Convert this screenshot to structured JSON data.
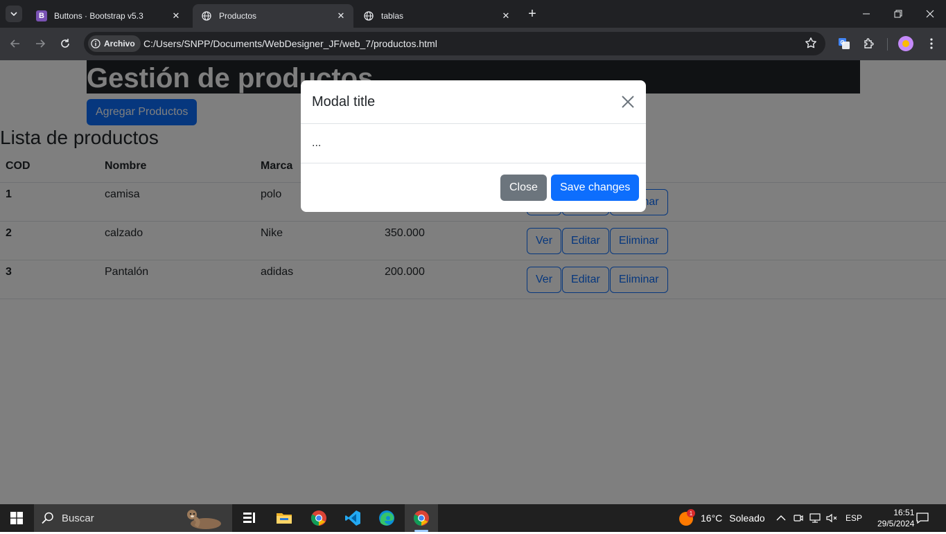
{
  "browser": {
    "tabs": [
      {
        "title": "Buttons · Bootstrap v5.3",
        "active": false
      },
      {
        "title": "Productos",
        "active": true
      },
      {
        "title": "tablas",
        "active": false
      }
    ],
    "security_chip": "Archivo",
    "url": "C:/Users/SNPP/Documents/WebDesigner_JF/web_7/productos.html",
    "bootstrap_favicon_letter": "B"
  },
  "page": {
    "heading": "Gestión de productos",
    "add_button": "Agregar Productos",
    "list_title": "Lista de productos",
    "table": {
      "headers": [
        "COD",
        "Nombre",
        "Marca",
        "",
        ""
      ],
      "rows": [
        {
          "cod": "1",
          "nombre": "camisa",
          "marca": "polo",
          "precio": ""
        },
        {
          "cod": "2",
          "nombre": "calzado",
          "marca": "Nike",
          "precio": "350.000"
        },
        {
          "cod": "3",
          "nombre": "Pantalón",
          "marca": "adidas",
          "precio": "200.000"
        }
      ],
      "actions": {
        "view": "Ver",
        "edit": "Editar",
        "delete": "Eliminar"
      }
    }
  },
  "modal": {
    "title": "Modal title",
    "body": "...",
    "close_label": "Close",
    "save_label": "Save changes"
  },
  "taskbar": {
    "search_placeholder": "Buscar",
    "weather": "16°C",
    "weather_desc": "Soleado",
    "weather_badge": "1",
    "language": "ESP",
    "time": "16:51",
    "date": "29/5/2024"
  },
  "colors": {
    "primary": "#0d6efd",
    "secondary": "#6c757d",
    "dark": "#212529"
  }
}
